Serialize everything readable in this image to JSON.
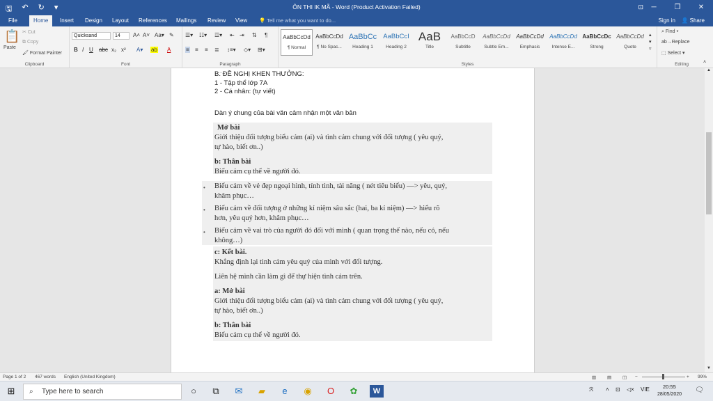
{
  "window": {
    "title": "ÔN THI IK MÃ - Word (Product Activation Failed)",
    "controls": [
      "─",
      "❐",
      "✕"
    ]
  },
  "tabs": [
    "File",
    "Home",
    "Insert",
    "Design",
    "Layout",
    "References",
    "Mailings",
    "Review",
    "View"
  ],
  "tell_me": "Tell me what you want to do...",
  "sign_in": "Sign in",
  "share": "Share",
  "clipboard": {
    "paste": "Paste",
    "cut": "Cut",
    "copy": "Copy",
    "format_painter": "Format Painter",
    "label": "Clipboard"
  },
  "font": {
    "name": "Quicksand",
    "size": "14",
    "label": "Font"
  },
  "paragraph_label": "Paragraph",
  "styles": {
    "label": "Styles",
    "items": [
      {
        "preview": "AaBbCcDd",
        "name": "¶ Normal"
      },
      {
        "preview": "AaBbCcDd",
        "name": "¶ No Spac..."
      },
      {
        "preview": "AaBbCc",
        "name": "Heading 1"
      },
      {
        "preview": "AaBbCcI",
        "name": "Heading 2"
      },
      {
        "preview": "AaB",
        "name": "Title"
      },
      {
        "preview": "AaBbCcD",
        "name": "Subtitle"
      },
      {
        "preview": "AaBbCcDd",
        "name": "Subtle Em..."
      },
      {
        "preview": "AaBbCcDd",
        "name": "Emphasis"
      },
      {
        "preview": "AaBbCcDd",
        "name": "Intense E..."
      },
      {
        "preview": "AaBbCcDc",
        "name": "Strong"
      },
      {
        "preview": "AaBbCcDd",
        "name": "Quote"
      }
    ]
  },
  "editing": {
    "find": "Find",
    "replace": "Replace",
    "select": "Select",
    "label": "Editing"
  },
  "document": {
    "lines_top": [
      "B. ĐỀ NGHỊ KHEN THƯỞNG:",
      "1 - Tập thể lớp 7A",
      "2 - Cá nhân: (tự viết)"
    ],
    "outline_title": "Dàn ý chung của bài văn cảm nhận một văn bản",
    "mo_bai_head": "Mở bài",
    "mo_bai_1": "Giới thiệu đối tượng biểu cảm (ai) và tình cảm chung với đối tượng ( yêu quý,",
    "mo_bai_2": "tự hào, biết ơn..)",
    "than_bai_head": "b: Thân bài",
    "than_bai_1": "Biểu cảm cụ thể về người đó.",
    "bullets": [
      [
        "Biểu cảm về vẻ đẹp ngoại hình, tính tình, tài năng ( nét tiêu biểu) —> yêu, quý,",
        "khâm phục…"
      ],
      [
        "Biểu cảm về đối tượng ở những kỉ niệm sâu sắc (hai, ba kỉ niệm) —> hiểu rõ",
        "hơn, yêu quý hơn, khâm phục…"
      ],
      [
        "Biểu cảm về vai trò của người đó đối với mình ( quan trọng thế nào, nếu có, nếu",
        "không…)"
      ]
    ],
    "ket_bai_head": "c: Kết bài.",
    "ket_bai_1": "Khẳng định lại tình cảm yêu quý của mình với đối tượng.",
    "ket_bai_2": "Liên hệ mình cần làm gì để thự hiện tình cảm trên.",
    "mo_bai2_head": "a: Mở bài",
    "mo_bai2_1": "Giới thiệu đối tượng biểu cảm (ai) và tình cảm chung với đối tượng ( yêu quý,",
    "mo_bai2_2": "tự hào, biết ơn..)",
    "than_bai2_head": "b: Thân bài",
    "than_bai2_1": "Biểu cảm cụ thể về người đó."
  },
  "status": {
    "page": "Page 1 of 2",
    "words": "467 words",
    "language": "English (United Kingdom)",
    "zoom": "99%"
  },
  "taskbar": {
    "search": "Type here to search",
    "lang": "VIE",
    "time": "20:55",
    "date": "28/05/2020"
  }
}
